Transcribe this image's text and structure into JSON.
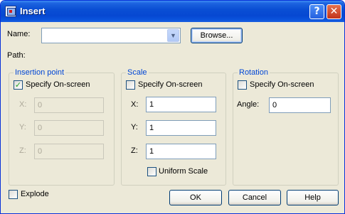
{
  "title": "Insert",
  "name": {
    "label": "Name:",
    "value": "",
    "browse_label": "Browse..."
  },
  "path": {
    "label": "Path:"
  },
  "insertion_point": {
    "title": "Insertion point",
    "specify_label": "Specify On-screen",
    "specify_checked": true,
    "x_label": "X:",
    "x_value": "0",
    "y_label": "Y:",
    "y_value": "0",
    "z_label": "Z:",
    "z_value": "0"
  },
  "scale": {
    "title": "Scale",
    "specify_label": "Specify On-screen",
    "specify_checked": false,
    "x_label": "X:",
    "x_value": "1",
    "y_label": "Y:",
    "y_value": "1",
    "z_label": "Z:",
    "z_value": "1",
    "uniform_label": "Uniform Scale",
    "uniform_checked": false
  },
  "rotation": {
    "title": "Rotation",
    "specify_label": "Specify On-screen",
    "specify_checked": false,
    "angle_label": "Angle:",
    "angle_value": "0"
  },
  "explode": {
    "label": "Explode",
    "checked": false
  },
  "buttons": {
    "ok": "OK",
    "cancel": "Cancel",
    "help": "Help"
  },
  "icons": {
    "help": "?",
    "close": "✕",
    "combo_arrow": "▼",
    "check": "✓"
  },
  "colors": {
    "titlebar": "#0a4fd4",
    "group_title": "#0046d5",
    "dialog_bg": "#ece9d8"
  }
}
